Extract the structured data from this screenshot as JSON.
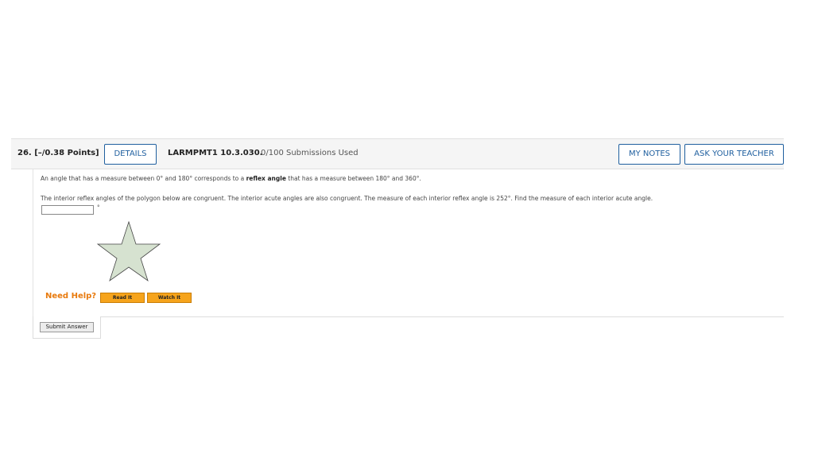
{
  "question": {
    "number_points": "26.  [–/0.38 Points]",
    "details_label": "DETAILS",
    "code": "LARMPMT1 10.3.030.",
    "submissions": "0/100 Submissions Used",
    "my_notes_label": "MY NOTES",
    "ask_teacher_label": "ASK YOUR TEACHER"
  },
  "body": {
    "line1_pre": "An angle that has a measure between 0° and 180° corresponds to a ",
    "line1_bold": "reflex angle",
    "line1_post": " that has a measure between 180° and 360°.",
    "line2": "The interior reflex angles of the polygon below are congruent. The interior acute angles are also congruent. The measure of each interior reflex angle is 252°. Find the measure of each interior acute angle.",
    "answer_value": "",
    "answer_unit": "°"
  },
  "figure": {
    "shape": "five-pointed star polygon",
    "fill_color": "#d6e2d0",
    "stroke_color": "#444444"
  },
  "help": {
    "label": "Need Help?",
    "read_label": "Read It",
    "watch_label": "Watch It"
  },
  "footer": {
    "submit_label": "Submit Answer"
  }
}
